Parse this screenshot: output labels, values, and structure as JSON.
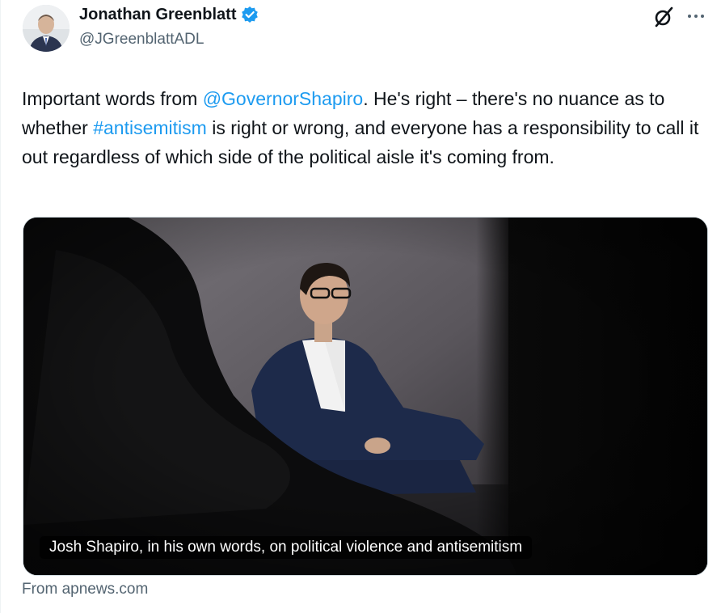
{
  "author": {
    "display_name": "Jonathan Greenblatt",
    "handle": "@JGreenblattADL",
    "verified_icon": "verified-badge-icon"
  },
  "header_actions": {
    "grok_icon": "grok-icon",
    "more_icon": "more-icon"
  },
  "tweet": {
    "text_1": "Important words from ",
    "mention": "@GovernorShapiro",
    "text_2": ". He's right –  there's no nuance as to whether ",
    "hashtag": "#antisemitism",
    "text_3": " is right or wrong, and everyone has a responsibility to call it out regardless of which side of the political aisle it's coming from."
  },
  "link_card": {
    "title": "Josh Shapiro, in his own words, on political violence and antisemitism",
    "source": "From apnews.com"
  },
  "colors": {
    "text": "#0f1419",
    "secondary": "#536471",
    "link": "#1d9bf0",
    "border": "#cfd9de"
  }
}
